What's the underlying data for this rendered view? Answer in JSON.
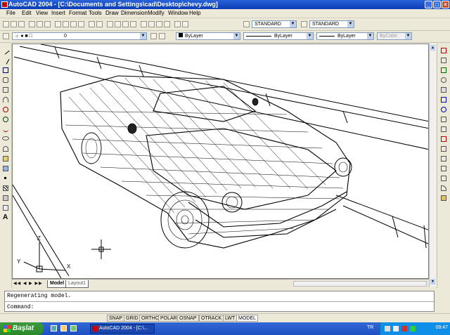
{
  "window": {
    "title": "AutoCAD 2004 - [C:\\Documents and Settings\\cad\\Desktop\\chevy.dwg]"
  },
  "menu": {
    "items": [
      "File",
      "Edit",
      "View",
      "Insert",
      "Format",
      "Tools",
      "Draw",
      "Dimension",
      "Modify",
      "Window",
      "Help"
    ]
  },
  "toolbar": {
    "text_style": "STANDARD",
    "dim_style": "STANDARD"
  },
  "layers": {
    "layer": "0",
    "color": "ByLayer",
    "linetype": "ByLayer",
    "lineweight": "ByLayer",
    "plotstyle": "ByColor"
  },
  "tabs": {
    "model": "Model",
    "layout": "Layout1"
  },
  "ucs": {
    "x_label": "X",
    "y_label": "Y",
    "z_label": "Z"
  },
  "command": {
    "history": "Regenerating model.",
    "prompt": "Command:"
  },
  "status": {
    "buttons": [
      "SNAP",
      "GRID",
      "ORTHO",
      "POLAR",
      "OSNAP",
      "OTRACK",
      "LWT",
      "MODEL"
    ]
  },
  "taskbar": {
    "start_label": "Başlat",
    "task_label": "AutoCAD 2004 - [C:\\...",
    "tray_lang": "TR",
    "clock": "09:47"
  },
  "colors": {
    "title_bar": "#0a3cb6",
    "taskbar": "#1e50c4",
    "start_button": "#2a8a2a"
  }
}
